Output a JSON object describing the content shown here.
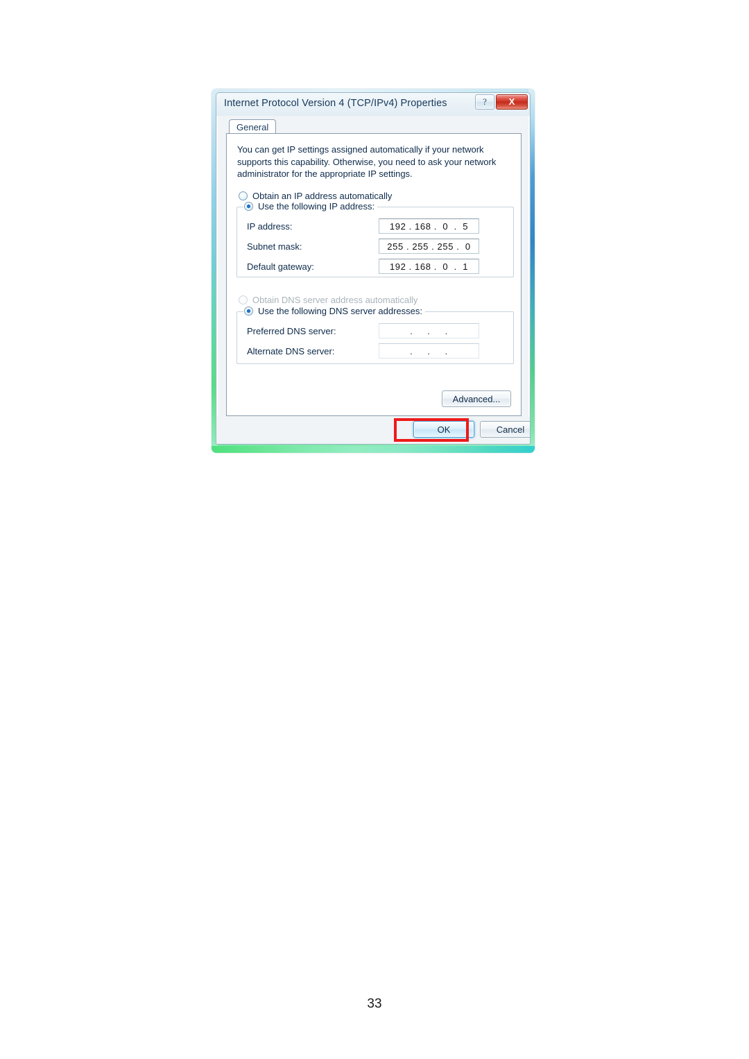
{
  "page": {
    "number": "33"
  },
  "dialog": {
    "title": "Internet Protocol Version 4 (TCP/IPv4) Properties",
    "caption_buttons": {
      "help_label": "?",
      "help_icon": "question-mark-icon",
      "close_label": "X",
      "close_icon": "close-icon",
      "close_color": "#c62b1c"
    },
    "tabs": [
      {
        "label": "General",
        "selected": true
      }
    ],
    "intro_text": "You can get IP settings assigned automatically if your network supports this capability. Otherwise, you need to ask your network administrator for the appropriate IP settings.",
    "ip_section": {
      "auto_option": {
        "label": "Obtain an IP address automatically",
        "selected": false,
        "disabled": false
      },
      "manual_option": {
        "label": "Use the following IP address:",
        "selected": true,
        "disabled": false
      },
      "fields": [
        {
          "label": "IP address:",
          "value": "192 . 168 .  0  .  5",
          "empty": false
        },
        {
          "label": "Subnet mask:",
          "value": "255 . 255 . 255 .  0",
          "empty": false
        },
        {
          "label": "Default gateway:",
          "value": "192 . 168 .  0  .  1",
          "empty": false
        }
      ]
    },
    "dns_section": {
      "auto_option": {
        "label": "Obtain DNS server address automatically",
        "selected": false,
        "disabled": true
      },
      "manual_option": {
        "label": "Use the following DNS server addresses:",
        "selected": true,
        "disabled": false
      },
      "fields": [
        {
          "label": "Preferred DNS server:",
          "value": " .     .     . ",
          "empty": true
        },
        {
          "label": "Alternate DNS server:",
          "value": " .     .     . ",
          "empty": true
        }
      ]
    },
    "advanced_button": {
      "label": "Advanced...",
      "enabled": true
    },
    "footer_buttons": {
      "ok_label": "OK",
      "ok_is_default": true,
      "cancel_label": "Cancel"
    }
  },
  "annotation": {
    "target": "ok-button",
    "shape": "rectangle",
    "color": "#ee1b1b"
  }
}
